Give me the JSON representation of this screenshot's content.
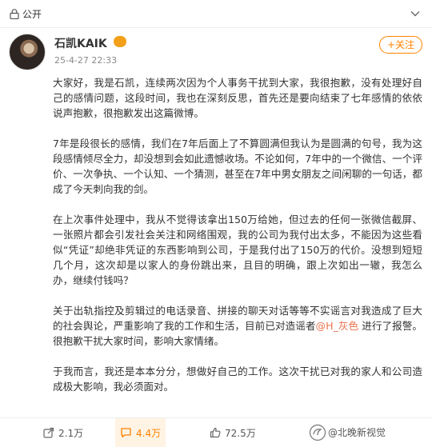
{
  "topbar": {
    "visibility": "公开"
  },
  "author": {
    "name": "石凯KAIK",
    "time": "25-4-27 22:33",
    "follow_label": "+关注"
  },
  "post": {
    "p1": "大家好，我是石凯，连续两次因为个人事务干扰到大家，我很抱歉，没有处理好自己的感情问题，这段时间，我也在深刻反思，首先还是要向结束了七年感情的依依说声抱歉，很抱歉发出这篇微博。",
    "p2": "7年是段很长的感情，我们在7年后面上了不算圆满但我认为是圆满的句号，我为这段感情倾尽全力，却没想到会如此遗憾收场。不论如何，7年中的一个微信、一个评价、一次争执、一个认知、一个猜测，甚至在7年中男女朋友之间闲聊的一句话，都成了今天刺向我的剑。",
    "p3": "在上次事件处理中，我从不觉得该拿出150万给她，但过去的任何一张微信截屏、一张照片都会引发社会关注和网络围观，我的公司为我付出太多，不能因为这些看似“凭证”却绝非凭证的东西影响到公司，于是我付出了150万的代价。没想到短短几个月，这次却是以家人的身份跳出来，且目的明确，跟上次如出一辙，我怎么办，继续付钱吗？",
    "p4_before": "关于出轨指控及剪辑过的电话录音、拼接的聊天对话等等不实谣言对我造成了巨大的社会舆论，严重影响了我的工作和生活，目前已对造谣者",
    "p4_mention": "@H_灰色",
    "p4_after": " 进行了报警。很抱歉干扰大家时间，影响大家情绪。",
    "p5": "于我而言，我还是本本分分，想做好自己的工作。这次干扰已对我的家人和公司造成极大影响，我必须面对。"
  },
  "actions": {
    "shares": "2.1万",
    "comments": "4.4万",
    "likes": "72.5万"
  },
  "watermark": {
    "text": "@北晚新视觉"
  },
  "colors": {
    "accent": "#ff8200",
    "mention": "#eb7350"
  }
}
